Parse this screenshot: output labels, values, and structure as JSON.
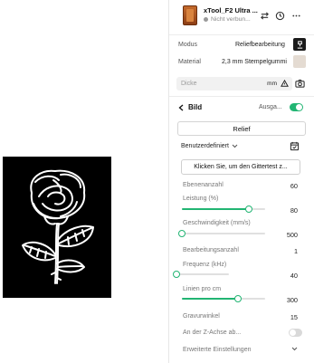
{
  "device": {
    "name": "xTool_F2 Ultra ...",
    "status": "Nicht verbun..."
  },
  "mode_row": {
    "label": "Modus",
    "value": "Reliefbearbeitung"
  },
  "material_row": {
    "label": "Material",
    "value": "2,3 mm Stempelgummi"
  },
  "thickness": {
    "placeholder": "Dicke",
    "unit": "mm"
  },
  "section": {
    "back_label": "Bild",
    "output_label": "Ausga...",
    "output_enabled": true
  },
  "relief_button": "Relief",
  "preset": {
    "label": "Benutzerdefiniert"
  },
  "grid_test_button": "Klicken Sie, um den Gittertest z...",
  "params": {
    "layers": {
      "label": "Ebenenanzahl",
      "value": "60"
    },
    "power": {
      "label": "Leistung (%)",
      "value": "80",
      "fraction": 0.8
    },
    "speed": {
      "label": "Geschwindigkeit (mm/s)",
      "value": "500",
      "fraction": 0.0
    },
    "passes": {
      "label": "Bearbeitungsanzahl",
      "value": "1"
    },
    "frequency": {
      "label": "Frequenz (kHz)",
      "value": "40",
      "fraction": 0.0
    },
    "lines": {
      "label": "Linien pro cm",
      "value": "300",
      "fraction": 0.67
    },
    "engrave_angle": {
      "label": "Gravurwinkel",
      "value": "15"
    },
    "z_axis": {
      "label": "An der Z-Achse ab...",
      "enabled": false
    },
    "advanced": {
      "label": "Erweiterte Einstellungen"
    }
  },
  "colors": {
    "accent": "#22b573"
  }
}
